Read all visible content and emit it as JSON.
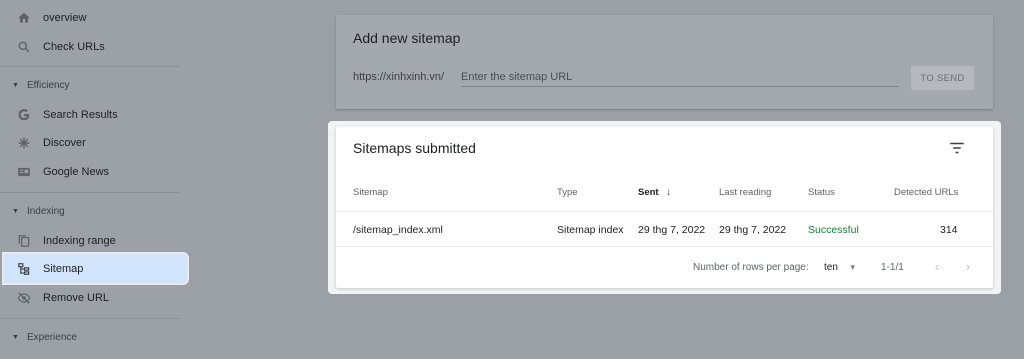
{
  "sidebar": {
    "items": [
      {
        "label": "overview",
        "icon": "home-icon"
      },
      {
        "label": "Check URLs",
        "icon": "search-icon"
      },
      {
        "label": "Search Results",
        "icon": "google-g-icon"
      },
      {
        "label": "Discover",
        "icon": "asterisk-icon"
      },
      {
        "label": "Google News",
        "icon": "news-icon"
      },
      {
        "label": "Indexing range",
        "icon": "copy-pages-icon"
      },
      {
        "label": "Sitemap",
        "icon": "sitemap-icon"
      },
      {
        "label": "Remove URL",
        "icon": "eye-off-icon"
      }
    ],
    "sections": {
      "efficiency": "Efficiency",
      "indexing": "Indexing",
      "experience": "Experience"
    }
  },
  "add_sitemap": {
    "title": "Add new sitemap",
    "prefix": "https://xinhxinh.vn/",
    "placeholder": "Enter the sitemap URL",
    "submit_label": "TO SEND"
  },
  "submitted": {
    "title": "Sitemaps submitted",
    "columns": {
      "sitemap": "Sitemap",
      "type": "Type",
      "sent": "Sent",
      "last_reading": "Last reading",
      "status": "Status",
      "detected_urls": "Detected URLs"
    },
    "rows": [
      {
        "sitemap": "/sitemap_index.xml",
        "type": "Sitemap index",
        "sent": "29 thg 7, 2022",
        "last_reading": "29 thg 7, 2022",
        "status": "Successful",
        "detected_urls": "314"
      }
    ],
    "footer": {
      "rows_per_page_label": "Number of rows per page:",
      "rows_per_page_value": "ten",
      "range": "1-1/1"
    }
  },
  "colors": {
    "status_success": "#188038",
    "active_nav": "#d2e3fc",
    "overlay": "#9aa0a6"
  }
}
